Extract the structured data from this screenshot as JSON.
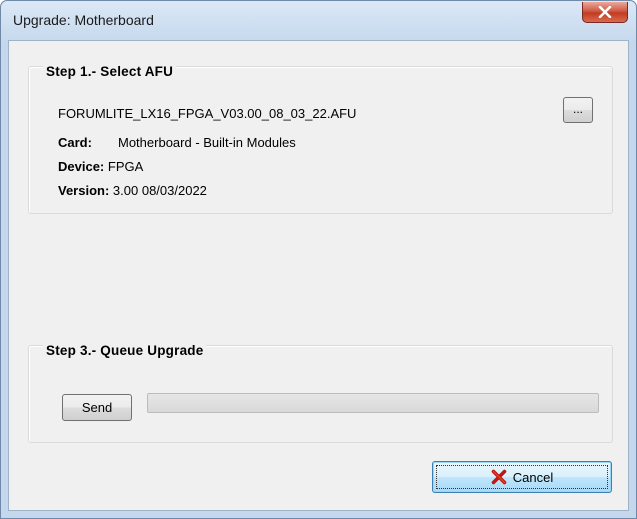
{
  "window": {
    "title": "Upgrade: Motherboard",
    "close_icon": "close-x-icon"
  },
  "step1": {
    "title": "Step 1.- Select AFU",
    "afu_file": "FORUMLITE_LX16_FPGA_V03.00_08_03_22.AFU",
    "browse_label": "...",
    "card_label": "Card:",
    "card_value": "Motherboard - Built-in Modules",
    "device_label": "Device:",
    "device_value": "FPGA",
    "version_label": "Version:",
    "version_value": "3.00 08/03/2022"
  },
  "step3": {
    "title": "Step 3.- Queue Upgrade",
    "send_label": "Send",
    "progress_percent": 0
  },
  "footer": {
    "cancel_label": "Cancel",
    "cancel_icon": "red-x-icon"
  },
  "colors": {
    "title_bar": "#c7d9ee",
    "close_button": "#c23b22",
    "client_bg": "#f0f0f0",
    "cancel_x": "#c0180c"
  }
}
